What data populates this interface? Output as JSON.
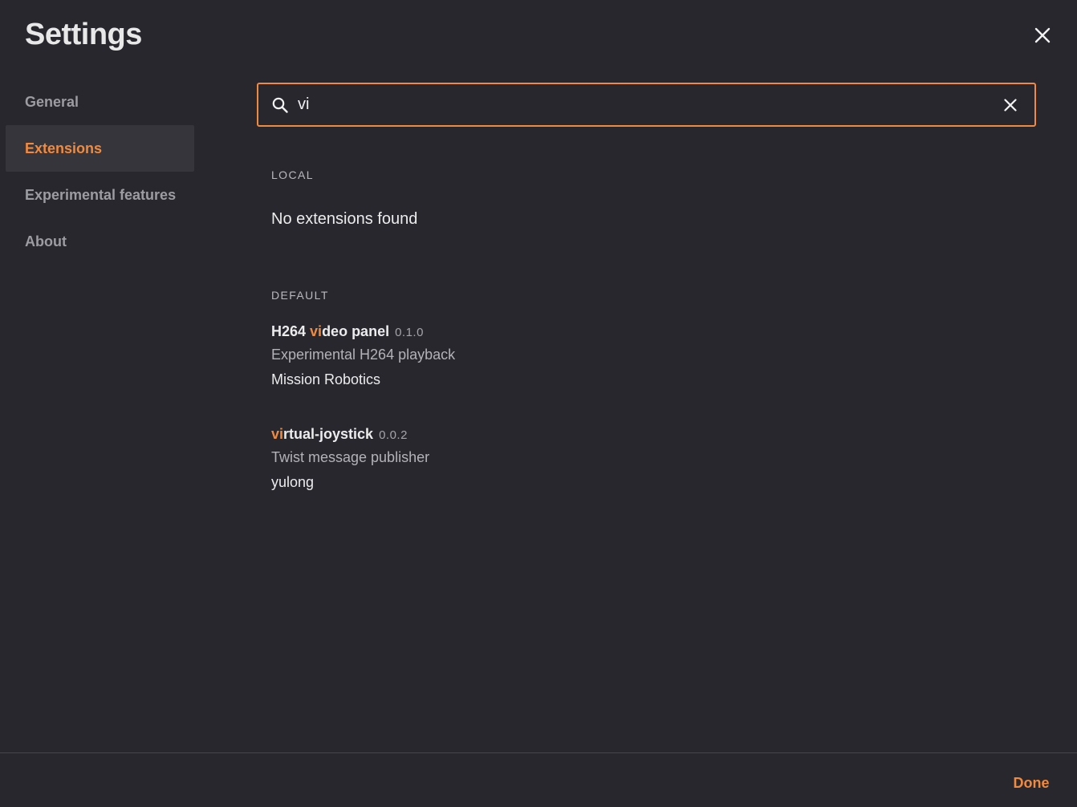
{
  "dialog": {
    "title": "Settings",
    "close_icon": "close-icon"
  },
  "sidebar": {
    "items": [
      {
        "label": "General",
        "active": false
      },
      {
        "label": "Extensions",
        "active": true
      },
      {
        "label": "Experimental features",
        "active": false
      },
      {
        "label": "About",
        "active": false
      }
    ]
  },
  "search": {
    "value": "vi",
    "placeholder": "",
    "search_icon": "search-icon",
    "clear_icon": "clear-icon"
  },
  "sections": {
    "local": {
      "label": "LOCAL",
      "empty_message": "No extensions found"
    },
    "default": {
      "label": "DEFAULT",
      "extensions": [
        {
          "name_before": "H264 ",
          "name_match": "vi",
          "name_after": "deo panel",
          "version": "0.1.0",
          "description": "Experimental H264 playback",
          "publisher": "Mission Robotics"
        },
        {
          "name_before": "",
          "name_match": "vi",
          "name_after": "rtual-joystick",
          "version": "0.0.2",
          "description": "Twist message publisher",
          "publisher": "yulong"
        }
      ]
    }
  },
  "footer": {
    "done_label": "Done"
  },
  "colors": {
    "background": "#27272d",
    "accent": "#f08a3e",
    "sidebar_active_bg": "#35353b",
    "muted_text": "#9c9ca2"
  }
}
